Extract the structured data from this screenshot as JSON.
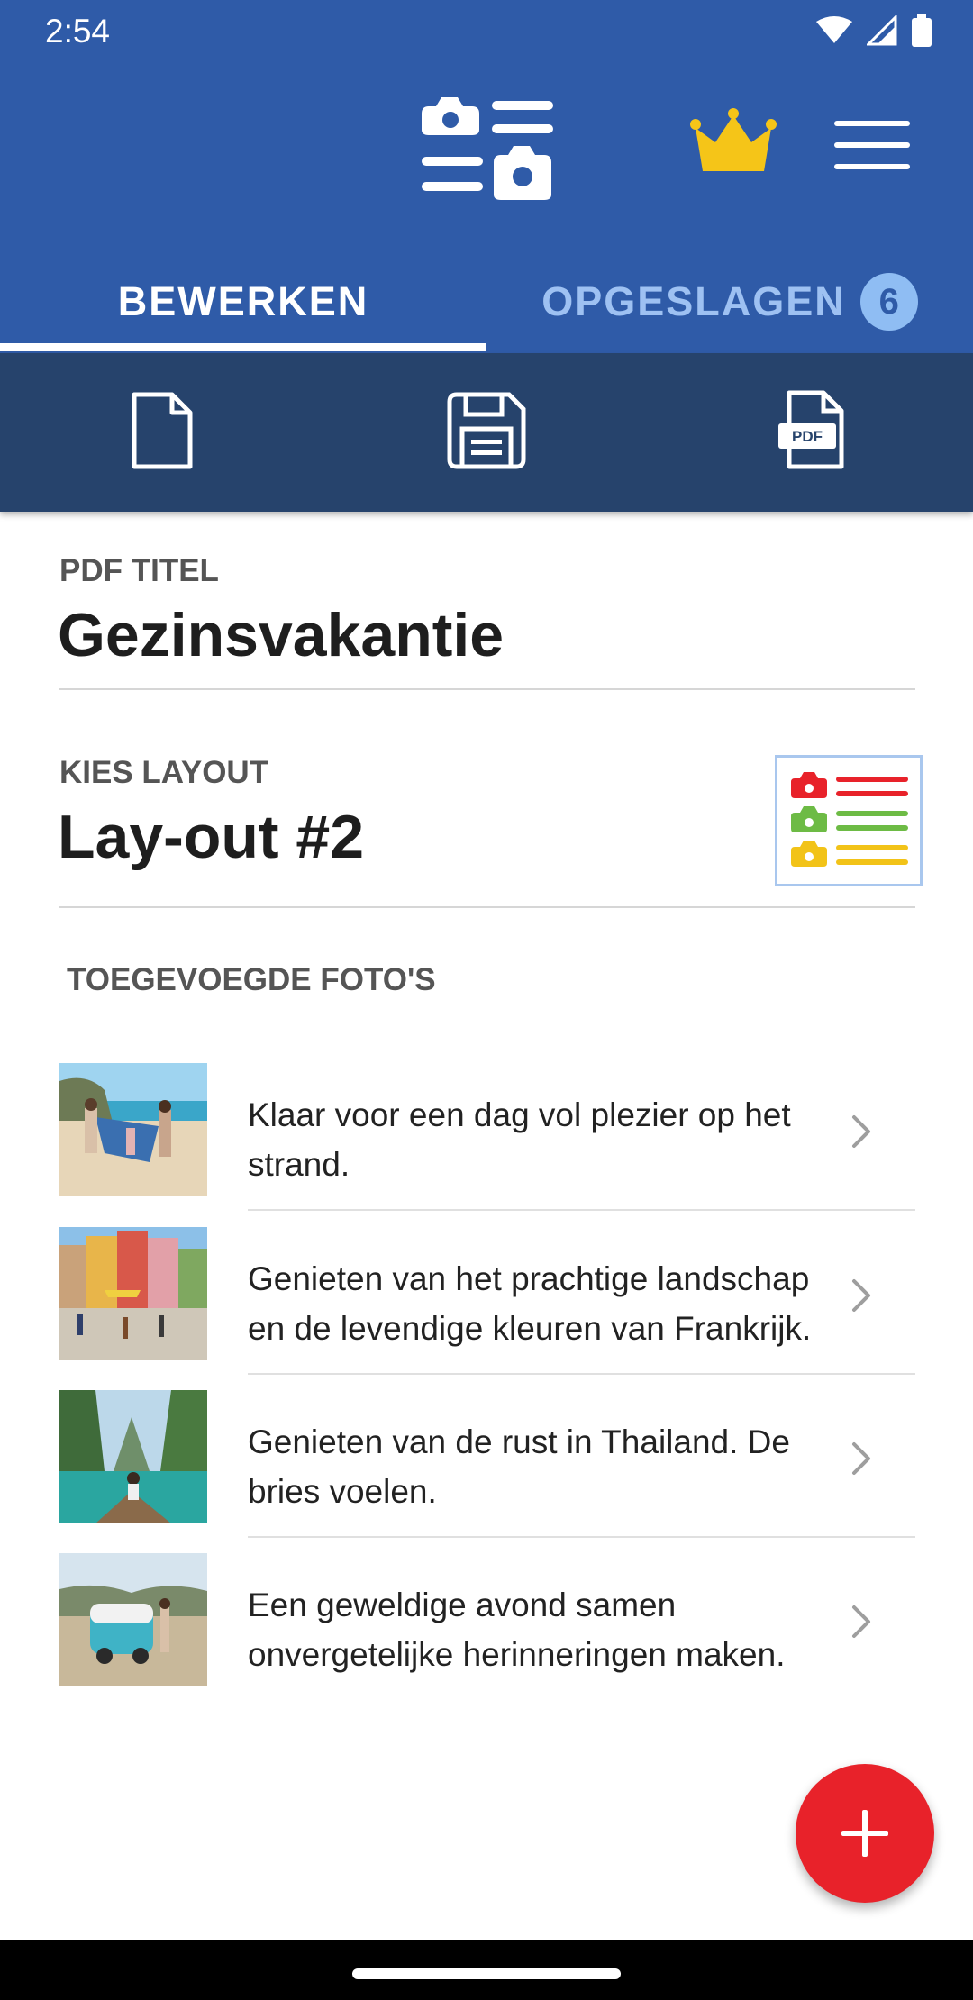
{
  "status_bar": {
    "time": "2:54"
  },
  "app_bar": {
    "logo_icon": "photo-list-logo-icon",
    "premium_icon": "crown-icon",
    "menu_icon": "hamburger-menu-icon"
  },
  "tabs": {
    "edit_label": "BEWERKEN",
    "saved_label": "OPGESLAGEN",
    "saved_count": "6",
    "active": "edit"
  },
  "toolbar": {
    "new_icon": "new-document-icon",
    "save_icon": "floppy-save-icon",
    "pdf_icon": "pdf-file-icon",
    "pdf_icon_text": "PDF"
  },
  "pdf_title": {
    "label": "PDF TITEL",
    "value": "Gezinsvakantie"
  },
  "layout": {
    "label": "KIES LAYOUT",
    "value": "Lay-out #2",
    "preview_colors": [
      "#e8222a",
      "#6dbb45",
      "#f2c318"
    ]
  },
  "photos": {
    "section_label": "TOEGEVOEGDE FOTO'S",
    "items": [
      {
        "caption": "Klaar voor een dag vol plezier op het strand."
      },
      {
        "caption": "Genieten van het prachtige landschap en de levendige kleuren van Frankrijk."
      },
      {
        "caption": "Genieten van de rust in Thailand. De bries voelen."
      },
      {
        "caption": "Een geweldige avond samen onvergetelijke herinneringen maken."
      }
    ]
  },
  "fab": {
    "icon": "plus-icon"
  },
  "colors": {
    "primary": "#2f5ba8",
    "toolbar": "#26436c",
    "accent": "#e8222a",
    "crown": "#f5c518"
  }
}
